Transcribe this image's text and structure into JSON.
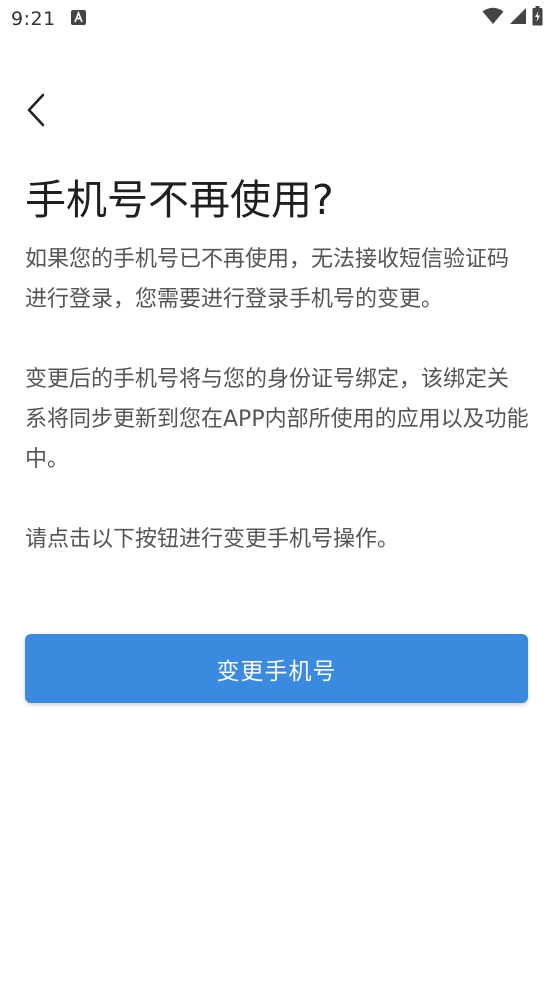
{
  "status_bar": {
    "time": "9:21",
    "notification_icon": "app-notification-icon",
    "icons": [
      "wifi-icon",
      "signal-icon",
      "battery-icon"
    ]
  },
  "nav": {
    "back_icon": "chevron-left-icon"
  },
  "page": {
    "title": "手机号不再使用?",
    "paragraphs": [
      "如果您的手机号已不再使用，无法接收短信验证码进行登录，您需要进行登录手机号的变更。",
      "变更后的手机号将与您的身份证号绑定，该绑定关系将同步更新到您在APP内部所使用的应用以及功能中。",
      "请点击以下按钮进行变更手机号操作。"
    ],
    "button_label": "变更手机号"
  },
  "colors": {
    "primary": "#3a8ae0",
    "text": "#555555",
    "title": "#1f1f1f"
  }
}
